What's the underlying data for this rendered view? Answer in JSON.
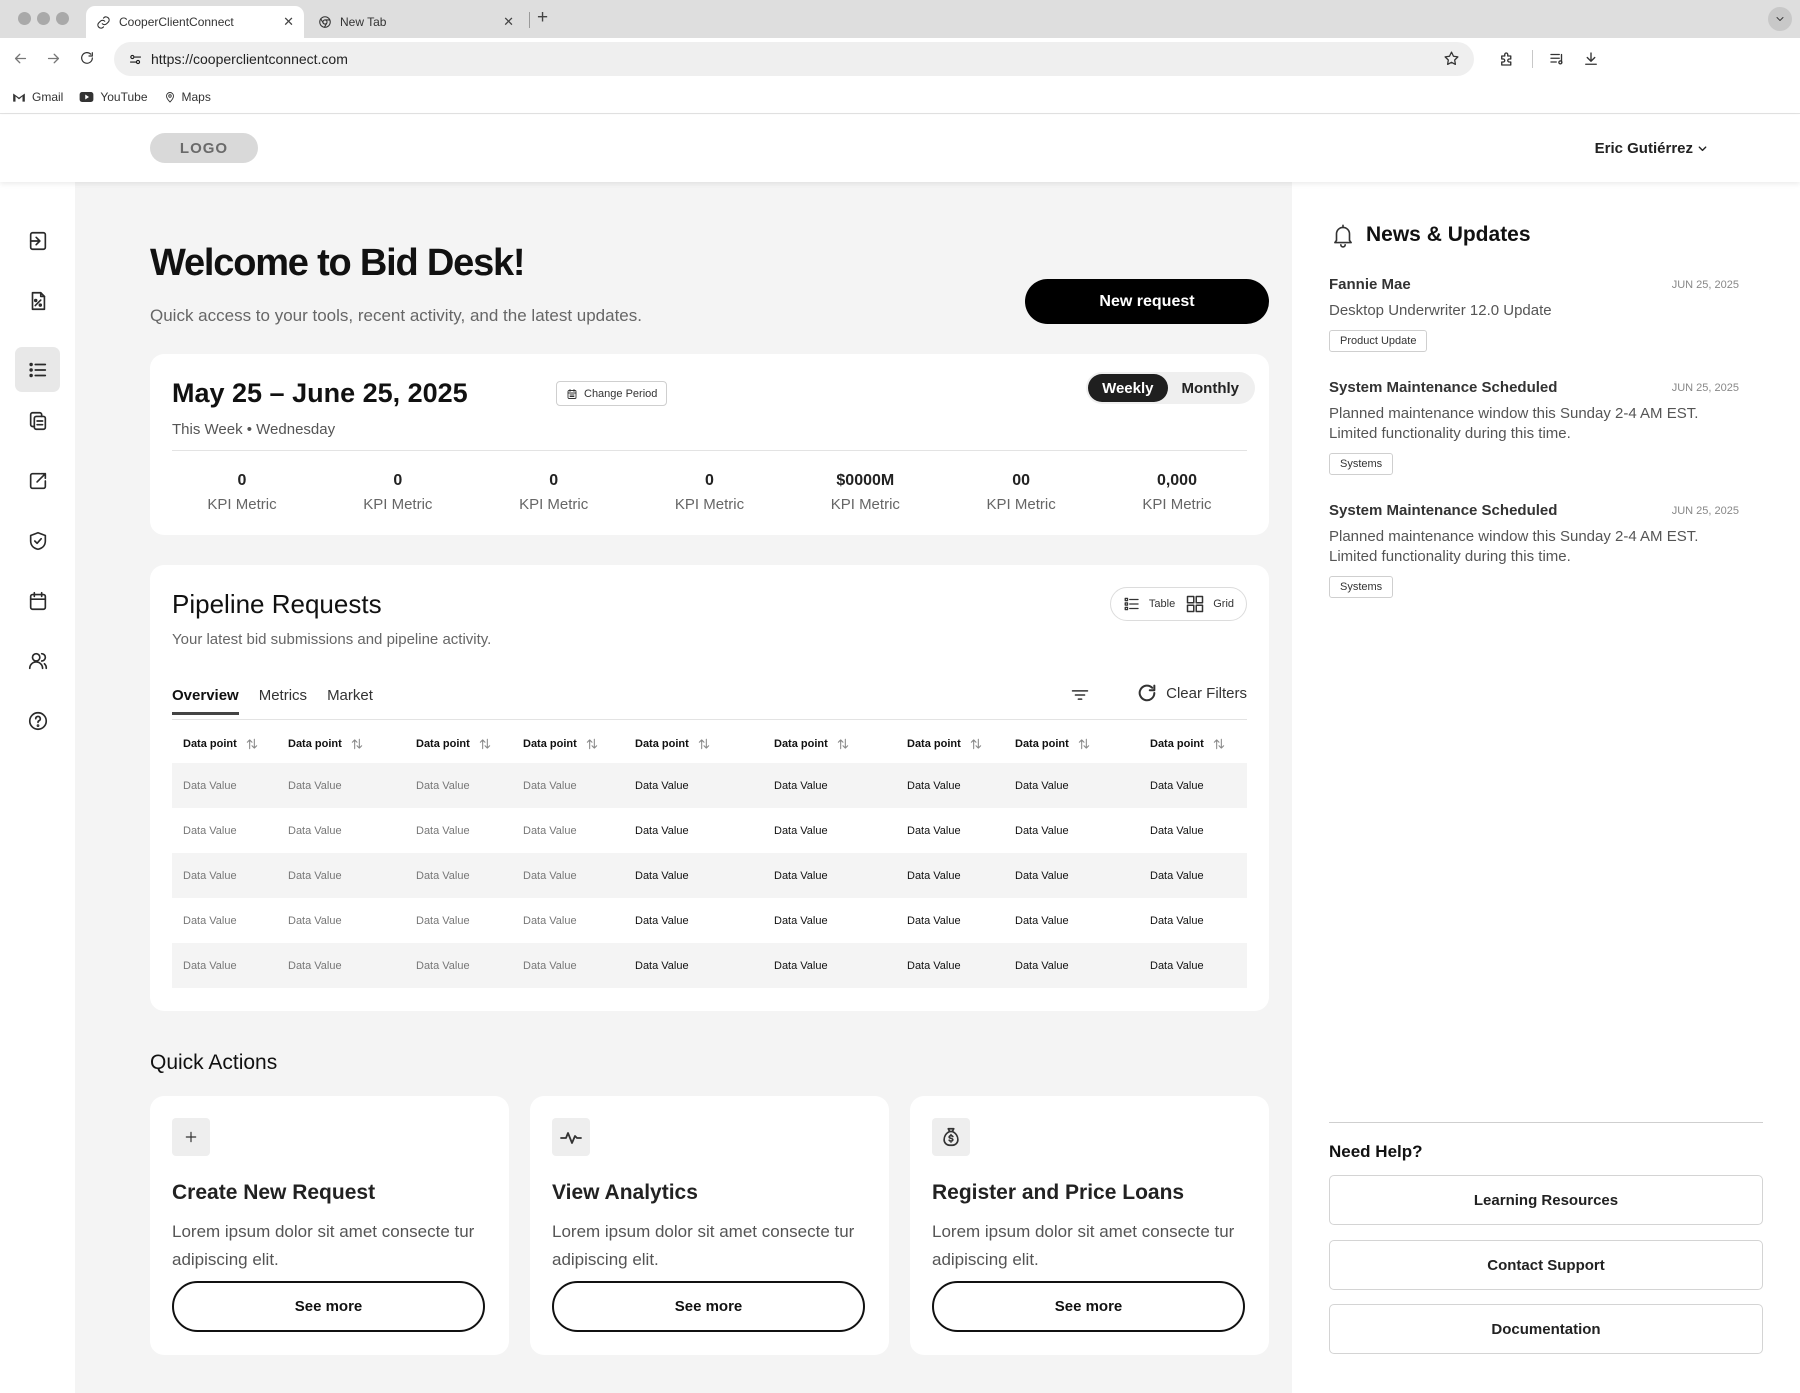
{
  "browser": {
    "tabs": [
      {
        "title": "CooperClientConnect",
        "active": true
      },
      {
        "title": "New Tab",
        "active": false
      }
    ],
    "url": "https://cooperclientconnect.com",
    "bookmarks": [
      "Gmail",
      "YouTube",
      "Maps"
    ]
  },
  "header": {
    "logo": "LOGO",
    "user_name": "Eric Gutiérrez"
  },
  "sidebar": {
    "items": [
      {
        "icon": "sign-in-icon"
      },
      {
        "icon": "percent-document-icon"
      },
      {
        "icon": "list-icon",
        "active": true
      },
      {
        "icon": "copy-documents-icon"
      },
      {
        "icon": "share-icon"
      },
      {
        "icon": "shield-check-icon"
      },
      {
        "icon": "calendar-icon"
      },
      {
        "icon": "users-icon"
      },
      {
        "icon": "help-icon"
      }
    ]
  },
  "welcome": {
    "title": "Welcome to Bid Desk!",
    "subtitle": "Quick access to your tools, recent activity, and the latest updates.",
    "new_request": "New request"
  },
  "period": {
    "title": "May 25 – June 25, 2025",
    "change_label": "Change Period",
    "subtitle": "This Week • Wednesday",
    "toggle": {
      "weekly": "Weekly",
      "monthly": "Monthly",
      "selected": "Weekly"
    },
    "kpis": [
      {
        "value": "0",
        "label": "KPI Metric"
      },
      {
        "value": "0",
        "label": "KPI Metric"
      },
      {
        "value": "0",
        "label": "KPI Metric"
      },
      {
        "value": "0",
        "label": "KPI Metric"
      },
      {
        "value": "$0000M",
        "label": "KPI Metric"
      },
      {
        "value": "00",
        "label": "KPI Metric"
      },
      {
        "value": "0,000",
        "label": "KPI Metric"
      }
    ]
  },
  "pipeline": {
    "title": "Pipeline Requests",
    "subtitle": "Your latest bid submissions and pipeline activity.",
    "view_table": "Table",
    "view_grid": "Grid",
    "tabs": [
      "Overview",
      "Metrics",
      "Market"
    ],
    "active_tab": "Overview",
    "clear_filters": "Clear Filters",
    "columns": [
      "Data point",
      "Data point",
      "Data point",
      "Data point",
      "Data point",
      "Data point",
      "Data point",
      "Data point",
      "Data point"
    ],
    "rows": [
      [
        "Data Value",
        "Data Value",
        "Data Value",
        "Data Value",
        "Data Value",
        "Data Value",
        "Data Value",
        "Data Value",
        "Data Value"
      ],
      [
        "Data Value",
        "Data Value",
        "Data Value",
        "Data Value",
        "Data Value",
        "Data Value",
        "Data Value",
        "Data Value",
        "Data Value"
      ],
      [
        "Data Value",
        "Data Value",
        "Data Value",
        "Data Value",
        "Data Value",
        "Data Value",
        "Data Value",
        "Data Value",
        "Data Value"
      ],
      [
        "Data Value",
        "Data Value",
        "Data Value",
        "Data Value",
        "Data Value",
        "Data Value",
        "Data Value",
        "Data Value",
        "Data Value"
      ],
      [
        "Data Value",
        "Data Value",
        "Data Value",
        "Data Value",
        "Data Value",
        "Data Value",
        "Data Value",
        "Data Value",
        "Data Value"
      ]
    ]
  },
  "quick_actions": {
    "title": "Quick Actions",
    "cards": [
      {
        "icon": "plus-icon",
        "title": "Create New Request",
        "desc": "Lorem ipsum dolor sit amet consecte tur adipiscing elit.",
        "button": "See more"
      },
      {
        "icon": "pulse-icon",
        "title": "View Analytics",
        "desc": "Lorem ipsum dolor sit amet consecte tur adipiscing elit.",
        "button": "See more"
      },
      {
        "icon": "money-bag-icon",
        "title": "Register and Price Loans",
        "desc": "Lorem ipsum dolor sit amet consecte tur adipiscing elit.",
        "button": "See more"
      }
    ]
  },
  "news": {
    "title": "News & Updates",
    "items": [
      {
        "title": "Fannie Mae",
        "date": "JUN 25, 2025",
        "body": "Desktop Underwriter 12.0 Update",
        "tag": "Product Update"
      },
      {
        "title": "System Maintenance Scheduled",
        "date": "JUN 25, 2025",
        "body": "Planned maintenance window this Sunday 2-4 AM EST. Limited functionality during this time.",
        "tag": "Systems"
      },
      {
        "title": "System Maintenance Scheduled",
        "date": "JUN 25, 2025",
        "body": "Planned maintenance window this Sunday 2-4 AM EST. Limited functionality during this time.",
        "tag": "Systems"
      }
    ]
  },
  "help": {
    "title": "Need Help?",
    "buttons": [
      "Learning Resources",
      "Contact Support",
      "Documentation"
    ]
  },
  "colors": {
    "primary": "#000000",
    "surface": "#ffffff",
    "background": "#f4f4f4"
  }
}
